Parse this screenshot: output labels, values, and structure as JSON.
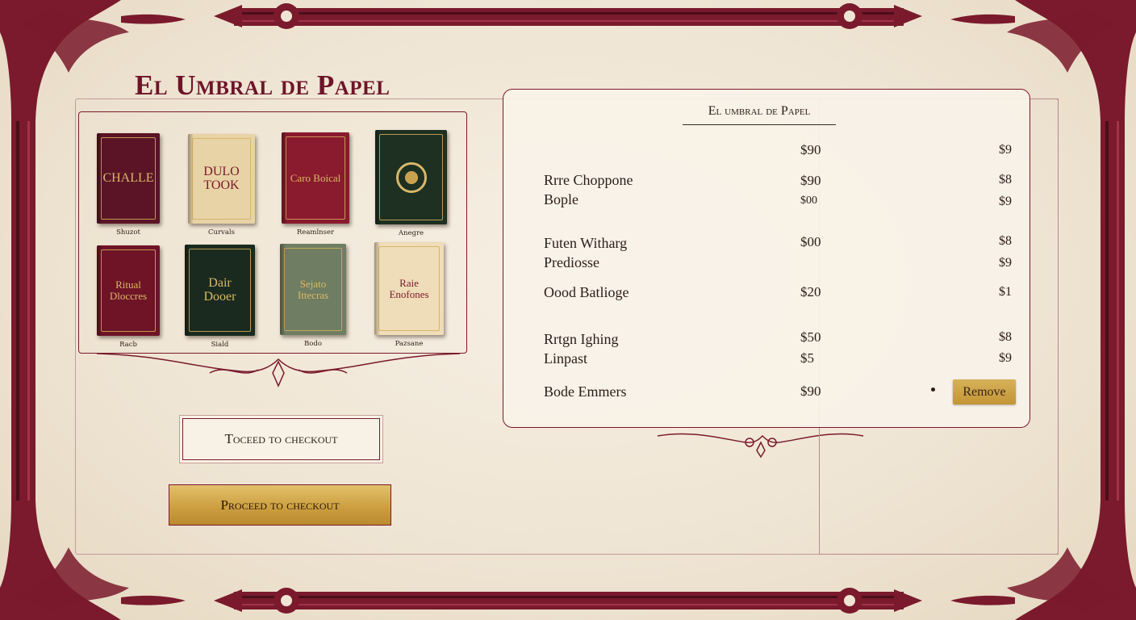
{
  "store": {
    "title": "El Umbral de Papel"
  },
  "books": [
    {
      "cover_text": "CHALLE",
      "caption": "Shuzot",
      "bg": "#5a1426"
    },
    {
      "cover_text": "DULO TOOK",
      "caption": "Curvals",
      "bg": "#e8d3a6"
    },
    {
      "cover_text": "Caro Boical",
      "caption": "Reamlnser",
      "bg": "#8a1a2e"
    },
    {
      "cover_text": "",
      "caption": "Anegre",
      "bg": "#1d3022"
    },
    {
      "cover_text": "Ritual Dloccres",
      "caption": "Racb",
      "bg": "#6e1426"
    },
    {
      "cover_text": "Dair Dooer",
      "caption": "Siald",
      "bg": "#1a2a1e"
    },
    {
      "cover_text": "Sejato Ittecras",
      "caption": "Bodo",
      "bg": "#6f7d62"
    },
    {
      "cover_text": "Raie Enofones",
      "caption": "Pazsane",
      "bg": "#efdcb8"
    }
  ],
  "cart": {
    "title": "El umbral de Papel",
    "header_price": "$90",
    "header_sub": "$9",
    "items": [
      {
        "name": "Rrre Choppone",
        "price": "$90",
        "sub": "$8"
      },
      {
        "name": "Bople",
        "price": "$00",
        "sub": "$9"
      },
      {
        "name": "Futen Witharg",
        "price": "$00",
        "sub": "$8"
      },
      {
        "name": "Prediosse",
        "price": "",
        "sub": "$9"
      },
      {
        "name": "Oood Batlioge",
        "price": "$20",
        "sub": "$1"
      },
      {
        "name": "Rrtgn Ighing",
        "price": "$50",
        "sub": "$8"
      },
      {
        "name": "Linpast",
        "price": "$5",
        "sub": "$9"
      },
      {
        "name": "Bode Emmers",
        "price": "$90",
        "sub": ""
      }
    ],
    "remove_label": "Remove"
  },
  "actions": {
    "outline_label": "Toceed to checkout",
    "checkout_label": "Proceed to checkout"
  },
  "colors": {
    "accent": "#7a1a2c",
    "gold": "#cda041",
    "paper": "#efe5d4"
  }
}
